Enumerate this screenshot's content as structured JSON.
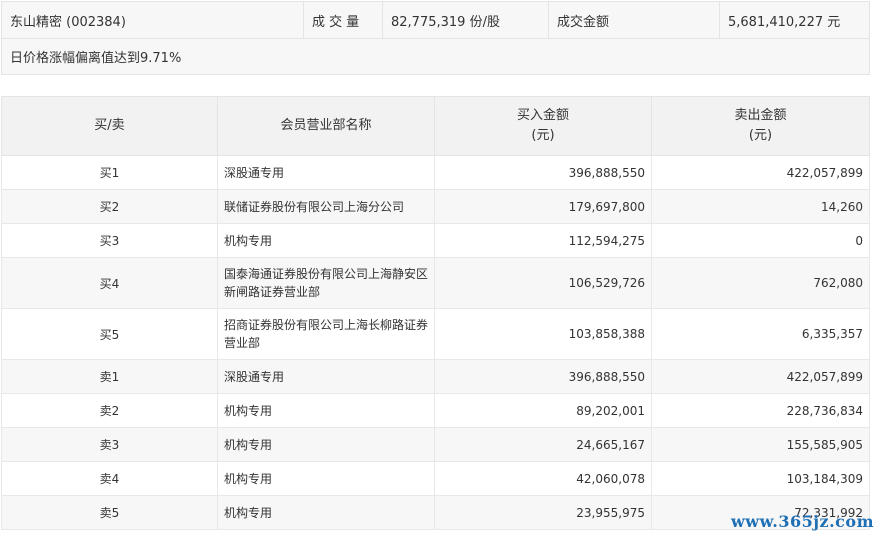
{
  "summary": {
    "stock": "东山精密 (002384)",
    "volume_label": "成 交 量",
    "volume_value": "82,775,319 份/股",
    "amount_label": "成交金额",
    "amount_value": "5,681,410,227 元",
    "note": "日价格涨幅偏离值达到9.71%"
  },
  "table": {
    "headers": {
      "side": "买/卖",
      "branch": "会员营业部名称",
      "buy_line1": "买入金额",
      "buy_line2": "(元)",
      "sell_line1": "卖出金额",
      "sell_line2": "(元)"
    },
    "rows": [
      {
        "side": "买1",
        "branch": "深股通专用",
        "buy": "396,888,550",
        "sell": "422,057,899"
      },
      {
        "side": "买2",
        "branch": "联储证券股份有限公司上海分公司",
        "buy": "179,697,800",
        "sell": "14,260"
      },
      {
        "side": "买3",
        "branch": "机构专用",
        "buy": "112,594,275",
        "sell": "0"
      },
      {
        "side": "买4",
        "branch": "国泰海通证券股份有限公司上海静安区新闸路证券营业部",
        "buy": "106,529,726",
        "sell": "762,080"
      },
      {
        "side": "买5",
        "branch": "招商证券股份有限公司上海长柳路证券营业部",
        "buy": "103,858,388",
        "sell": "6,335,357"
      },
      {
        "side": "卖1",
        "branch": "深股通专用",
        "buy": "396,888,550",
        "sell": "422,057,899"
      },
      {
        "side": "卖2",
        "branch": "机构专用",
        "buy": "89,202,001",
        "sell": "228,736,834"
      },
      {
        "side": "卖3",
        "branch": "机构专用",
        "buy": "24,665,167",
        "sell": "155,585,905"
      },
      {
        "side": "卖4",
        "branch": "机构专用",
        "buy": "42,060,078",
        "sell": "103,184,309"
      },
      {
        "side": "卖5",
        "branch": "机构专用",
        "buy": "23,955,975",
        "sell": "72,331,992"
      }
    ]
  },
  "watermark": "www.365jz.com"
}
